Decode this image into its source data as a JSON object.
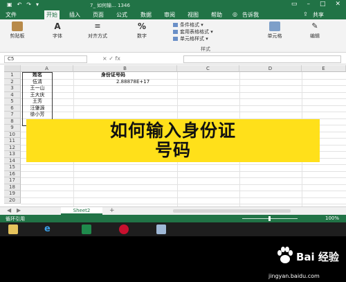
{
  "titlebar": {
    "doc_title": "7_ 如何输...   1346",
    "share_label": "共享"
  },
  "menu": {
    "tabs": [
      "文件",
      "开始",
      "插入",
      "页面",
      "公式",
      "数据",
      "审阅",
      "视图",
      "帮助",
      "告诉我"
    ],
    "active": "开始"
  },
  "ribbon": {
    "groups": [
      {
        "label": "剪贴板",
        "icon": "clipboard-icon"
      },
      {
        "label": "字体",
        "icon": "font-icon"
      },
      {
        "label": "对齐方式",
        "icon": "align-icon"
      },
      {
        "label": "数字",
        "icon": "percent-icon"
      },
      {
        "label": "单元格",
        "icon": "cells-icon"
      },
      {
        "label": "编辑",
        "icon": "edit-icon"
      }
    ],
    "style_items": [
      "条件格式 ▾",
      "套用表格格式 ▾",
      "单元格样式 ▾"
    ],
    "style_group_label": "样式"
  },
  "formula_bar": {
    "name_box": "C5",
    "fx_symbols": "×  ✓  fx",
    "value": ""
  },
  "sheet": {
    "columns": [
      "A",
      "B",
      "C",
      "D",
      "E"
    ],
    "rows": [
      "1",
      "2",
      "3",
      "4",
      "5",
      "6",
      "7",
      "8",
      "9",
      "10",
      "11",
      "12",
      "13",
      "14",
      "15",
      "16",
      "17",
      "18",
      "19",
      "20"
    ],
    "cells": {
      "A1": "姓名",
      "A2": "伍清",
      "A3": "王一山",
      "A4": "王大庆",
      "A5": "王芳",
      "A6": "汪肇源",
      "A7": "徐小芳",
      "B1": "身份证号码",
      "B2": "2.88878E+17"
    }
  },
  "banner": {
    "line1": "如何输入身份证",
    "line2": "号码",
    "color": "#ffe01a"
  },
  "sheet_tabs": {
    "active": "Sheet2",
    "add": "+"
  },
  "statusbar": {
    "left": "循环引用",
    "zoom": "100%"
  },
  "watermark": {
    "text": "Bai 经验",
    "url": "jingyan.baidu.com"
  },
  "colors": {
    "excel_green": "#217346",
    "banner_yellow": "#ffe01a"
  }
}
